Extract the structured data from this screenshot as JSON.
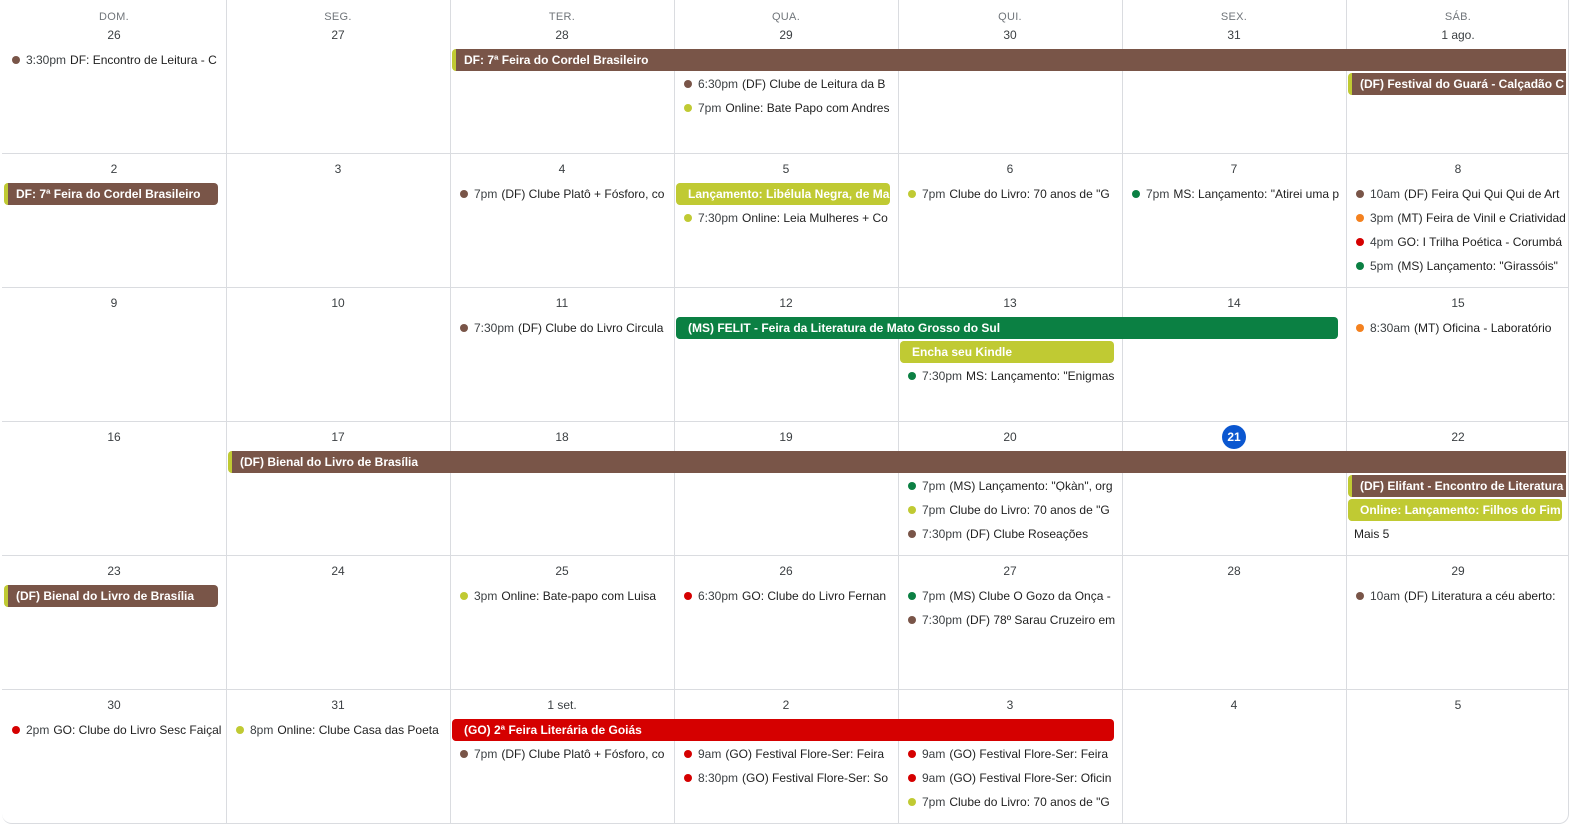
{
  "colors": {
    "brown": "#795548",
    "lime": "#c0ca33",
    "green": "#0b8043",
    "red": "#d50000",
    "orange": "#f4811f",
    "today": "#0b57d0"
  },
  "weekdays": [
    "DOM.",
    "SEG.",
    "TER.",
    "QUA.",
    "QUI.",
    "SEX.",
    "SÁB."
  ],
  "weeks": [
    {
      "days": [
        "26",
        "27",
        "28",
        "29",
        "30",
        "31",
        "1 ago."
      ],
      "bars": [
        {
          "title": "DF: 7ª Feira do Cordel Brasileiro",
          "start": 2,
          "end": 6,
          "slot": 0,
          "color": "brown",
          "continues": true
        },
        {
          "title": "(DF) Festival do Guará - Calçadão C",
          "start": 6,
          "end": 6,
          "slot": 1,
          "color": "brown",
          "continues": true
        }
      ],
      "events": [
        {
          "day": 0,
          "slot": 0,
          "time": "3:30pm",
          "title": "DF: Encontro de Leitura - C",
          "color": "brown"
        },
        {
          "day": 3,
          "slot": 1,
          "time": "6:30pm",
          "title": "(DF) Clube de Leitura da B",
          "color": "brown"
        },
        {
          "day": 3,
          "slot": 2,
          "time": "7pm",
          "title": "Online: Bate Papo com Andres",
          "color": "lime"
        }
      ]
    },
    {
      "days": [
        "2",
        "3",
        "4",
        "5",
        "6",
        "7",
        "8"
      ],
      "bars": [
        {
          "title": "DF: 7ª Feira do Cordel Brasileiro",
          "start": 0,
          "end": 0,
          "slot": 0,
          "color": "brown",
          "continued": true
        },
        {
          "title": "Lançamento: Libélula Negra, de Mal",
          "start": 3,
          "end": 3,
          "slot": 0,
          "color": "lime"
        }
      ],
      "events": [
        {
          "day": 2,
          "slot": 0,
          "time": "7pm",
          "title": "(DF) Clube Platô + Fósforo, co",
          "color": "brown"
        },
        {
          "day": 3,
          "slot": 1,
          "time": "7:30pm",
          "title": "Online: Leia Mulheres + Co",
          "color": "lime"
        },
        {
          "day": 4,
          "slot": 0,
          "time": "7pm",
          "title": "Clube do Livro: 70 anos de \"G",
          "color": "lime"
        },
        {
          "day": 5,
          "slot": 0,
          "time": "7pm",
          "title": "MS: Lançamento: \"Atirei uma p",
          "color": "green"
        },
        {
          "day": 6,
          "slot": 0,
          "time": "10am",
          "title": "(DF) Feira Qui Qui Qui de Art",
          "color": "brown"
        },
        {
          "day": 6,
          "slot": 1,
          "time": "3pm",
          "title": "(MT) Feira de Vinil e Criatividade",
          "color": "orange"
        },
        {
          "day": 6,
          "slot": 2,
          "time": "4pm",
          "title": "GO: I Trilha Poética - Corumbá",
          "color": "red"
        },
        {
          "day": 6,
          "slot": 3,
          "time": "5pm",
          "title": "(MS) Lançamento: \"Girassóis\"",
          "color": "green"
        }
      ]
    },
    {
      "days": [
        "9",
        "10",
        "11",
        "12",
        "13",
        "14",
        "15"
      ],
      "bars": [
        {
          "title": "(MS) FELIT - Feira da Literatura de Mato Grosso do Sul",
          "start": 3,
          "end": 5,
          "slot": 0,
          "color": "green"
        },
        {
          "title": "Encha seu Kindle",
          "start": 4,
          "end": 4,
          "slot": 1,
          "color": "lime"
        }
      ],
      "events": [
        {
          "day": 2,
          "slot": 0,
          "time": "7:30pm",
          "title": "(DF) Clube do Livro Circula",
          "color": "brown"
        },
        {
          "day": 4,
          "slot": 2,
          "time": "7:30pm",
          "title": "MS: Lançamento: \"Enigmas",
          "color": "green"
        },
        {
          "day": 6,
          "slot": 0,
          "time": "8:30am",
          "title": "(MT) Oficina - Laboratório",
          "color": "orange"
        }
      ]
    },
    {
      "days": [
        "16",
        "17",
        "18",
        "19",
        "20",
        "21",
        "22"
      ],
      "today_index": 5,
      "bars": [
        {
          "title": "(DF) Bienal do Livro de Brasília",
          "start": 1,
          "end": 6,
          "slot": 0,
          "color": "brown",
          "continues": true
        },
        {
          "title": "(DF) Elifant - Encontro de Literatura",
          "start": 6,
          "end": 6,
          "slot": 1,
          "color": "brown",
          "continues": true
        },
        {
          "title": "Online: Lançamento: Filhos do Fim d",
          "start": 6,
          "end": 6,
          "slot": 2,
          "color": "lime"
        }
      ],
      "events": [
        {
          "day": 4,
          "slot": 1,
          "time": "7pm",
          "title": "(MS) Lançamento: \"Ọkàn\", org",
          "color": "green"
        },
        {
          "day": 4,
          "slot": 2,
          "time": "7pm",
          "title": "Clube do Livro: 70 anos de \"G",
          "color": "lime"
        },
        {
          "day": 4,
          "slot": 3,
          "time": "7:30pm",
          "title": "(DF) Clube Roseações",
          "color": "brown"
        }
      ],
      "more": {
        "day": 6,
        "slot": 3,
        "label": "Mais 5"
      }
    },
    {
      "days": [
        "23",
        "24",
        "25",
        "26",
        "27",
        "28",
        "29"
      ],
      "bars": [
        {
          "title": "(DF) Bienal do Livro de Brasília",
          "start": 0,
          "end": 0,
          "slot": 0,
          "color": "brown",
          "continued": true
        }
      ],
      "events": [
        {
          "day": 2,
          "slot": 0,
          "time": "3pm",
          "title": "Online: Bate-papo com Luisa",
          "color": "lime"
        },
        {
          "day": 3,
          "slot": 0,
          "time": "6:30pm",
          "title": "GO: Clube do Livro Fernan",
          "color": "red"
        },
        {
          "day": 4,
          "slot": 0,
          "time": "7pm",
          "title": "(MS) Clube O Gozo da Onça -",
          "color": "green"
        },
        {
          "day": 4,
          "slot": 1,
          "time": "7:30pm",
          "title": "(DF) 78º Sarau Cruzeiro em",
          "color": "brown"
        },
        {
          "day": 6,
          "slot": 0,
          "time": "10am",
          "title": "(DF) Literatura a céu aberto:",
          "color": "brown"
        }
      ]
    },
    {
      "days": [
        "30",
        "31",
        "1 set.",
        "2",
        "3",
        "4",
        "5"
      ],
      "bars": [
        {
          "title": "(GO) 2ª Feira Literária de Goiás",
          "start": 2,
          "end": 4,
          "slot": 0,
          "color": "red"
        }
      ],
      "events": [
        {
          "day": 0,
          "slot": 0,
          "time": "2pm",
          "title": "GO: Clube do Livro Sesc Faiçal",
          "color": "red"
        },
        {
          "day": 1,
          "slot": 0,
          "time": "8pm",
          "title": "Online: Clube Casa das Poeta",
          "color": "lime"
        },
        {
          "day": 2,
          "slot": 1,
          "time": "7pm",
          "title": "(DF) Clube Platô + Fósforo, co",
          "color": "brown"
        },
        {
          "day": 3,
          "slot": 1,
          "time": "9am",
          "title": "(GO) Festival Flore-Ser: Feira",
          "color": "red"
        },
        {
          "day": 3,
          "slot": 2,
          "time": "8:30pm",
          "title": "(GO) Festival Flore-Ser: So",
          "color": "red"
        },
        {
          "day": 4,
          "slot": 1,
          "time": "9am",
          "title": "(GO) Festival Flore-Ser: Feira",
          "color": "red"
        },
        {
          "day": 4,
          "slot": 2,
          "time": "9am",
          "title": "(GO) Festival Flore-Ser: Oficin",
          "color": "red"
        },
        {
          "day": 4,
          "slot": 3,
          "time": "7pm",
          "title": "Clube do Livro: 70 anos de \"G",
          "color": "lime"
        }
      ]
    }
  ]
}
